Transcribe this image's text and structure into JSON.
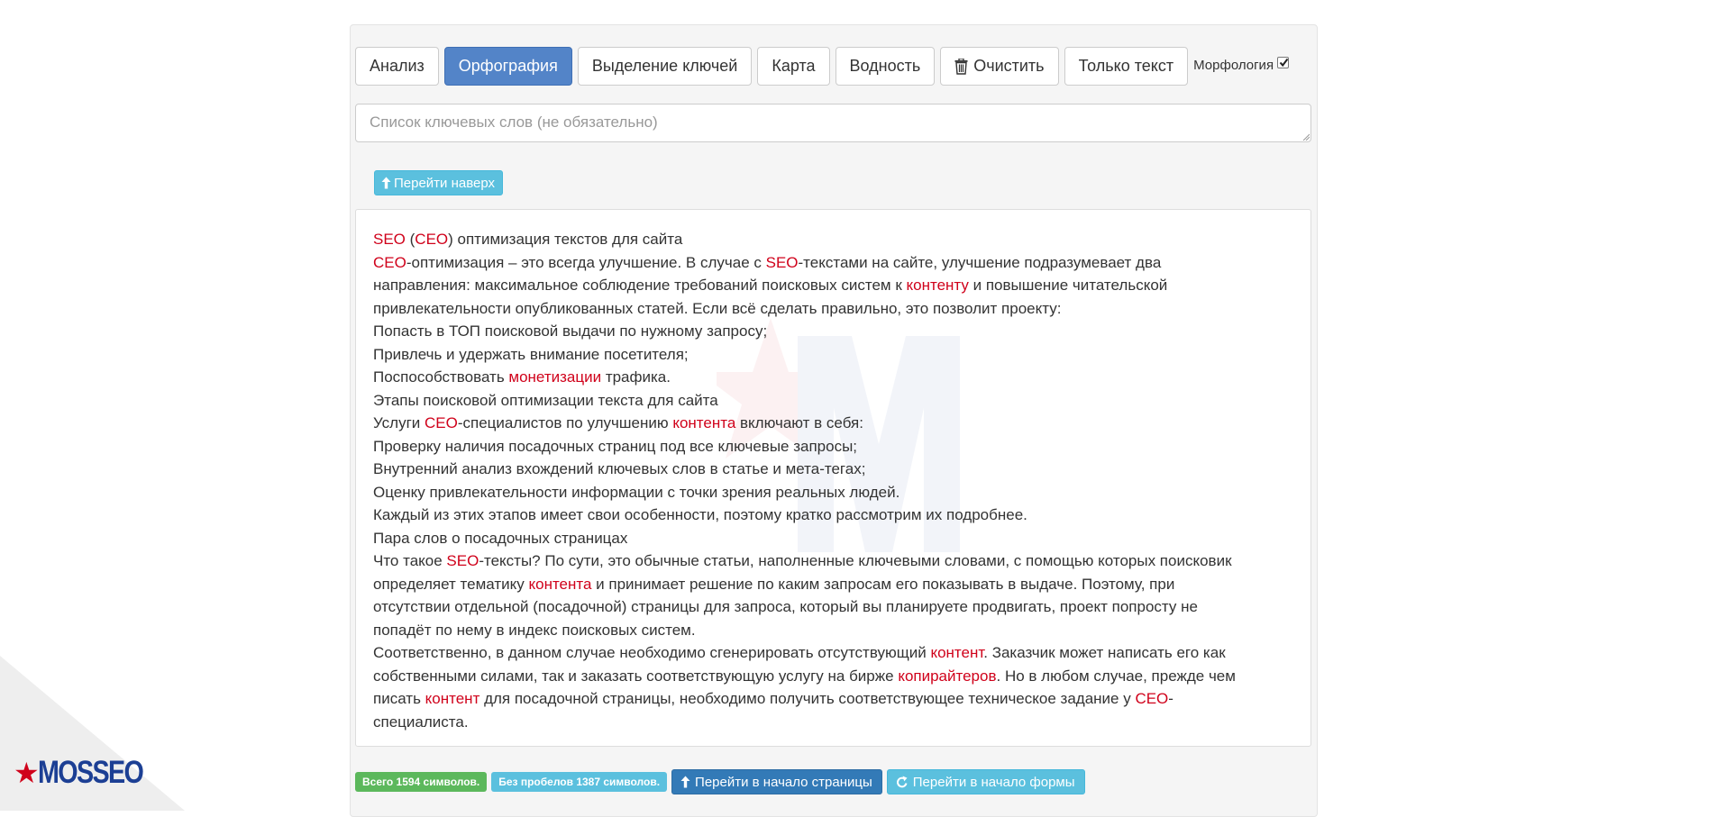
{
  "logo": {
    "text": "MOSSEO",
    "colors": {
      "star": "#d0021b",
      "text": "#1c3f94"
    }
  },
  "toolbar": {
    "buttons": [
      {
        "label": "Анализ",
        "active": false
      },
      {
        "label": "Орфография",
        "active": true
      },
      {
        "label": "Выделение ключей",
        "active": false
      },
      {
        "label": "Карта",
        "active": false
      },
      {
        "label": "Водность",
        "active": false
      },
      {
        "label": "Очистить",
        "active": false,
        "icon": "trash-icon"
      },
      {
        "label": "Только текст",
        "active": false
      }
    ],
    "morphology": {
      "label": "Морфология",
      "checked": true
    }
  },
  "keywords_input": {
    "placeholder": "Список ключевых слов (не обязательно)",
    "value": ""
  },
  "go_up_button": {
    "label": "Перейти наверх",
    "icon": "arrow-up-icon"
  },
  "text": {
    "lines": [
      [
        [
          "SEO",
          true
        ],
        [
          " (",
          false
        ],
        [
          "СЕО",
          true
        ],
        [
          ") оптимизация текстов для сайта",
          false
        ]
      ],
      [
        [
          "СЕО",
          true
        ],
        [
          "-оптимизация – это всегда улучшение. В случае с ",
          false
        ],
        [
          "SEO",
          true
        ],
        [
          "-текстами на сайте, улучшение подразумевает два",
          false
        ]
      ],
      [
        [
          "направления: максимальное соблюдение требований поисковых систем к ",
          false
        ],
        [
          "контенту",
          true
        ],
        [
          " и повышение читательской",
          false
        ]
      ],
      [
        [
          "привлекательности опубликованных статей. Если всё сделать правильно, это позволит проекту:",
          false
        ]
      ],
      [
        [
          "Попасть в ТОП поисковой выдачи по нужному запросу;",
          false
        ]
      ],
      [
        [
          "Привлечь и удержать внимание посетителя;",
          false
        ]
      ],
      [
        [
          "Поспособствовать ",
          false
        ],
        [
          "монетизации",
          true
        ],
        [
          " трафика.",
          false
        ]
      ],
      [
        [
          "Этапы поисковой оптимизации текста для сайта",
          false
        ]
      ],
      [
        [
          "Услуги ",
          false
        ],
        [
          "СЕО",
          true
        ],
        [
          "-специалистов по улучшению ",
          false
        ],
        [
          "контента",
          true
        ],
        [
          " включают в себя:",
          false
        ]
      ],
      [
        [
          "Проверку наличия посадочных страниц под все ключевые запросы;",
          false
        ]
      ],
      [
        [
          "Внутренний анализ вхождений ключевых слов в статье и мета-тегах;",
          false
        ]
      ],
      [
        [
          "Оценку привлекательности информации с точки зрения реальных людей.",
          false
        ]
      ],
      [
        [
          "Каждый из этих этапов имеет свои особенности, поэтому кратко рассмотрим их подробнее.",
          false
        ]
      ],
      [
        [
          "Пара слов о посадочных страницах",
          false
        ]
      ],
      [
        [
          "Что такое ",
          false
        ],
        [
          "SEO",
          true
        ],
        [
          "-тексты? По сути, это обычные статьи, наполненные ключевыми словами, с помощью которых поисковик",
          false
        ]
      ],
      [
        [
          "определяет тематику ",
          false
        ],
        [
          "контента",
          true
        ],
        [
          " и принимает решение по каким запросам его показывать в выдаче. Поэтому, при",
          false
        ]
      ],
      [
        [
          "отсутствии отдельной (посадочной) страницы для запроса, который вы планируете продвигать, проект попросту не",
          false
        ]
      ],
      [
        [
          "попадёт по нему в индекс поисковых систем.",
          false
        ]
      ],
      [
        [
          "Соответственно, в данном случае необходимо сгенерировать отсутствующий ",
          false
        ],
        [
          "контент",
          true
        ],
        [
          ". Заказчик может написать его как",
          false
        ]
      ],
      [
        [
          "собственными силами, так и заказать соответствующую услугу на бирже ",
          false
        ],
        [
          "копирайтеров",
          true
        ],
        [
          ". Но в любом случае, прежде чем",
          false
        ]
      ],
      [
        [
          "писать ",
          false
        ],
        [
          "контент",
          true
        ],
        [
          " для посадочной страницы, необходимо получить соответствующее техническое задание у ",
          false
        ],
        [
          "СЕО",
          true
        ],
        [
          "-",
          false
        ]
      ],
      [
        [
          "специалиста.",
          false
        ]
      ]
    ],
    "colors": {
      "keyword": "#d0021b",
      "text": "#333333"
    }
  },
  "bottom": {
    "total_label": "Всего 1594 символов.",
    "no_spaces_label": "Без пробелов 1387 символов.",
    "page_top_button": {
      "label": "Перейти в начало страницы",
      "icon": "arrow-up-icon"
    },
    "form_top_button": {
      "label": "Перейти в начало формы",
      "icon": "refresh-icon"
    }
  },
  "colors": {
    "panel_bg": "#f5f5f5",
    "primary": "#5384c8",
    "info": "#5bc0de",
    "success": "#5cb85c",
    "dark_primary": "#337ab7"
  }
}
